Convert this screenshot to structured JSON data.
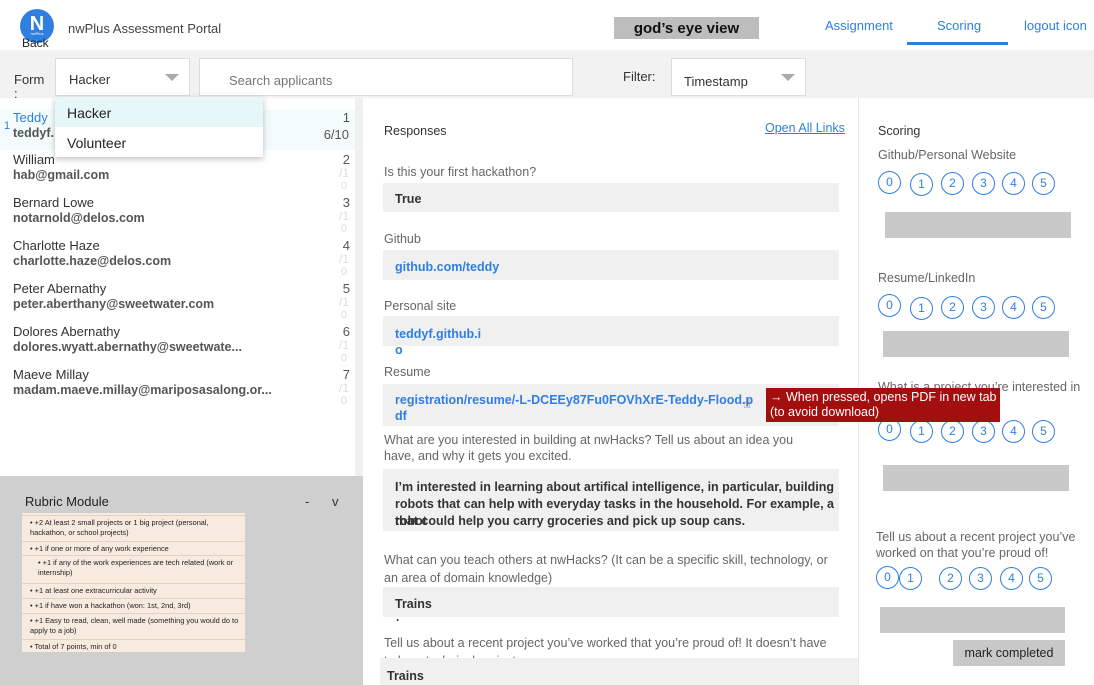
{
  "header": {
    "logo_text": "N",
    "logo_small_text": "nwPlus",
    "back_label": "Back",
    "app_name": "nwPlus Assessment Portal",
    "gods_eye_label": "god’s eye view",
    "nav": {
      "assignment": "Assignment",
      "scoring": "Scoring",
      "logout": "logout icon"
    }
  },
  "filterbar": {
    "form_label": "Form :",
    "form_value": "Hacker",
    "search_placeholder": "Search applicants",
    "filter_label": "Filter:",
    "filter_value": "Timestamp"
  },
  "dropdown": {
    "options": [
      "Hacker",
      "Volunteer"
    ]
  },
  "applicants": {
    "selected_marker": "1",
    "items": [
      {
        "name": "Teddy",
        "email": "teddyf.",
        "index": "1",
        "score": "6/10",
        "score_zero": ""
      },
      {
        "name": "William",
        "email": "hab@gmail.com",
        "index": "2",
        "score": "/1",
        "score_zero": "0"
      },
      {
        "name": "Bernard Lowe",
        "email": "notarnold@delos.com",
        "index": "3",
        "score": "/1",
        "score_zero": "0"
      },
      {
        "name": "Charlotte Haze",
        "email": "charlotte.haze@delos.com",
        "index": "4",
        "score": "/1",
        "score_zero": "0"
      },
      {
        "name": "Peter Abernathy",
        "email": "peter.aberthany@sweetwater.com",
        "index": "5",
        "score": "/1",
        "score_zero": "0"
      },
      {
        "name": "Dolores Abernathy",
        "email": "dolores.wyatt.abernathy@sweetwate...",
        "index": "6",
        "score": "/1",
        "score_zero": "0"
      },
      {
        "name": "Maeve Millay",
        "email": "madam.maeve.millay@mariposasalong.or...",
        "index": "7",
        "score": "/1",
        "score_zero": "0"
      }
    ]
  },
  "rubric": {
    "title": "Rubric Module",
    "minimize": "-",
    "toggle": "v",
    "lines": [
      "•  +2 At least 2 small projects or 1 big project (personal, hackathon, or school projects)",
      "•  +1 if one or more of any work experience",
      "•  +1 if any of the work experiences are tech related (work or internship)",
      "•  +1 at least one extracurricular activity",
      "•  +1 if have won a hackathon (won: 1st, 2nd, 3rd)",
      "•  +1 Easy to read, clean, well made (something you would do to apply to a job)",
      "•  Total of 7 points, min of 0"
    ]
  },
  "responses": {
    "title": "Responses",
    "open_all_links": "Open All Links",
    "q1": "Is this your first hackathon?",
    "a1": "True",
    "q2": "Github",
    "a2": "github.com/teddy",
    "q3": "Personal site",
    "a3_line1": "teddyf.github.i",
    "a3_line2": "o",
    "q4": "Resume",
    "a4_line1": "registration/resume/-L-DCEEy87Fu0FOVhXrE-Teddy-Flood.p",
    "a4_line2": "df",
    "q5_line1": "What are you interested in building at nwHacks? Tell us about an idea you",
    "q5_line2": "have, and why it gets you excited.",
    "a5_line1": "I’m interested in learning about artifical intelligence, in particular, building",
    "a5_line2": "robots that can help with everyday tasks in the household. For example, a robot",
    "a5_line3": "that could help you carry groceries and pick up soup cans.",
    "q6_line1": "What can you teach others at nwHacks? (It can be a specific skill, technology, or",
    "q6_line2": "an area of domain knowledge)",
    "a6": "Trains",
    "a6_dot": ".",
    "q7_line1": "Tell us about a recent project you’ve worked that you’re proud of! It doesn’t have",
    "q7_line2": "to be a technical project.",
    "a7": "Trains",
    "tooltip_line1": "→ When pressed, opens PDF in new tab",
    "tooltip_line2": "(to avoid download)"
  },
  "scoring": {
    "title": "Scoring",
    "q1": "Github/Personal Website",
    "q2": "Resume/LinkedIn",
    "q3": "What is a project you’re interested in",
    "q4_line1": "Tell us about a recent project you’ve",
    "q4_line2": "worked on that you’re proud of!",
    "scale": [
      "0",
      "1",
      "2",
      "3",
      "4",
      "5"
    ],
    "mark_completed": "mark completed"
  }
}
